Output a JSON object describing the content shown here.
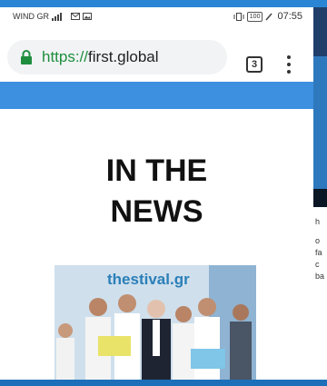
{
  "status_bar": {
    "carrier": "WIND GR",
    "battery": "100",
    "time": "07:55"
  },
  "browser": {
    "url_scheme": "https://",
    "url_host": "first.global",
    "tab_count": "3"
  },
  "article": {
    "headline_line1": "IN THE",
    "headline_line2": "NEWS",
    "photo_logo": "thestival.gr"
  },
  "side_app": {
    "chars": [
      "h",
      "o",
      "fa",
      "c",
      "ba"
    ]
  },
  "colors": {
    "accent_blue": "#3d8fe0",
    "url_scheme_green": "#1e8e3e"
  }
}
